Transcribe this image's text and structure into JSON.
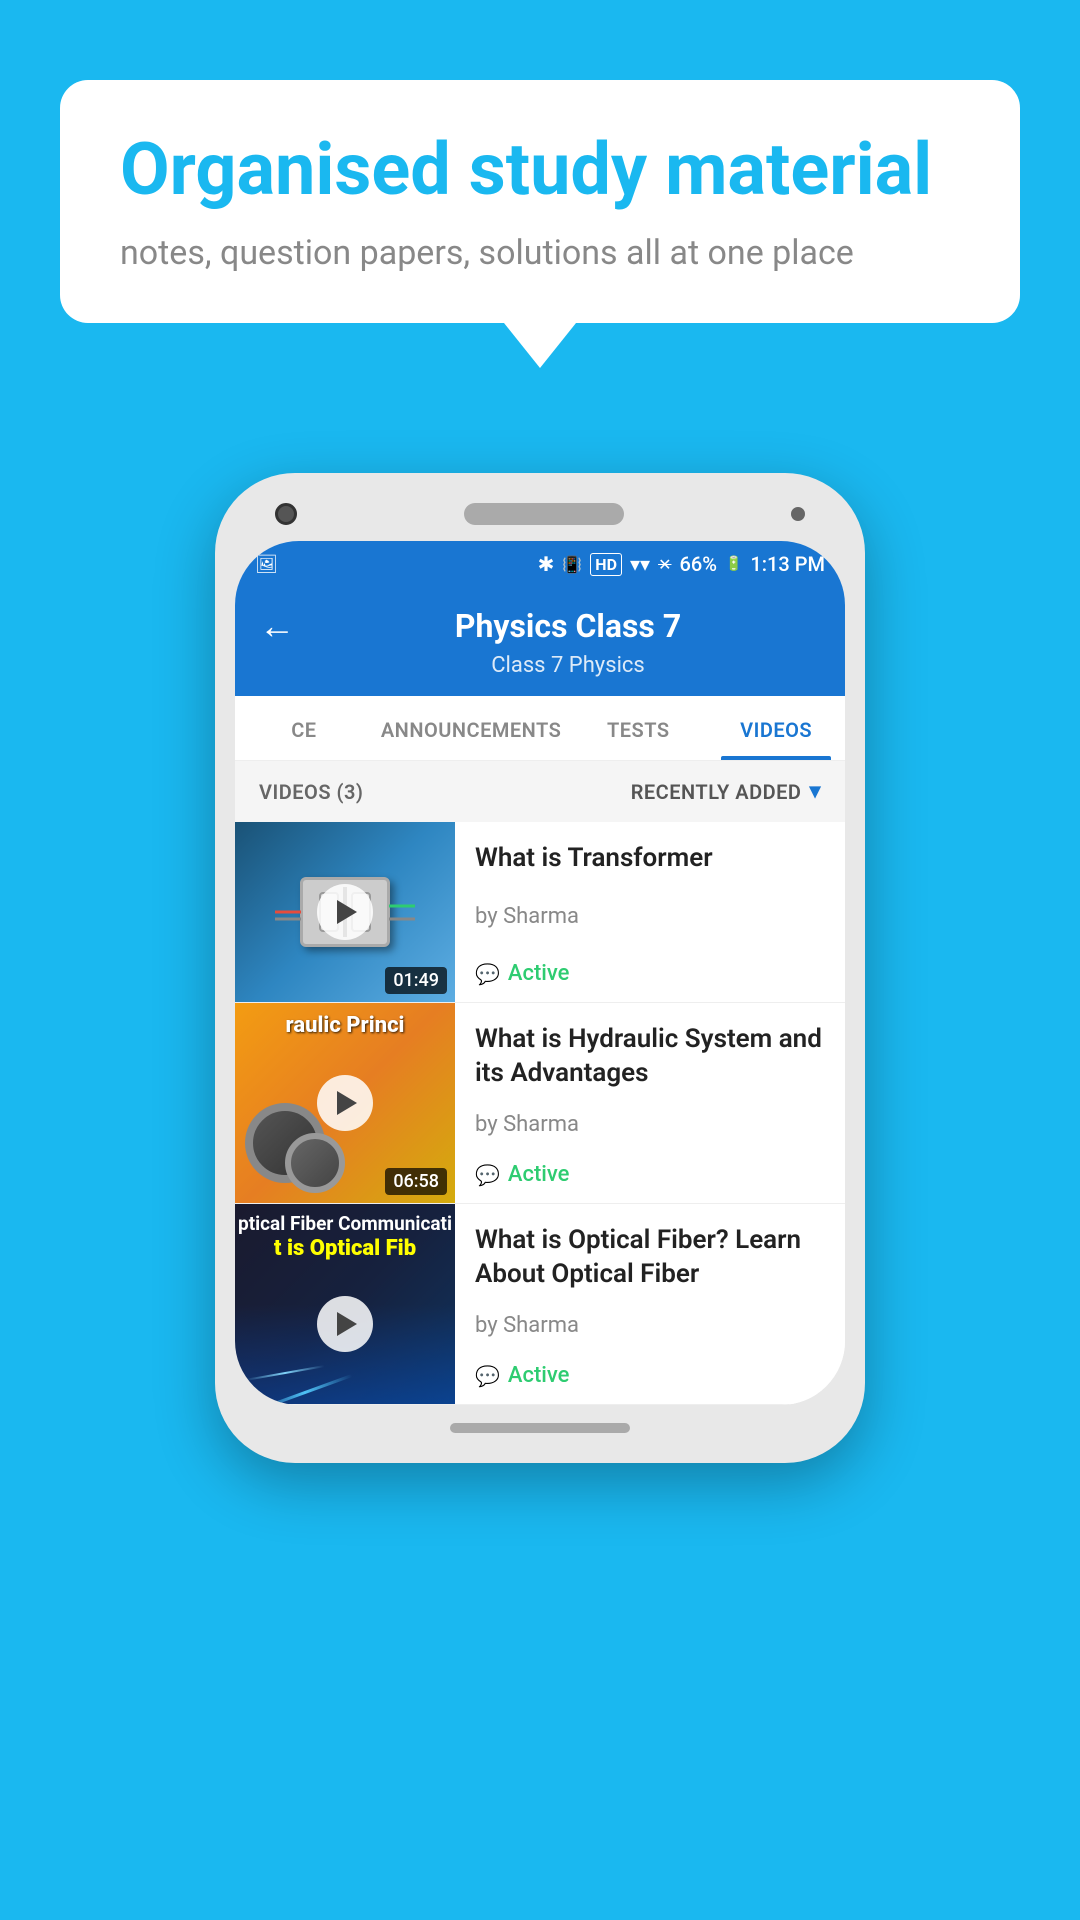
{
  "page": {
    "background_color": "#1ab8f0"
  },
  "speech_bubble": {
    "title": "Organised study material",
    "subtitle": "notes, question papers, solutions all at one place"
  },
  "status_bar": {
    "time": "1:13 PM",
    "battery": "66%",
    "signal_icons": "🔵📶📶"
  },
  "app_bar": {
    "back_label": "←",
    "title": "Physics Class 7",
    "breadcrumb": "Class 7   Physics"
  },
  "tabs": [
    {
      "id": "ce",
      "label": "CE",
      "active": false
    },
    {
      "id": "announcements",
      "label": "ANNOUNCEMENTS",
      "active": false
    },
    {
      "id": "tests",
      "label": "TESTS",
      "active": false
    },
    {
      "id": "videos",
      "label": "VIDEOS",
      "active": true
    }
  ],
  "videos_header": {
    "count_label": "VIDEOS (3)",
    "sort_label": "RECENTLY ADDED"
  },
  "videos": [
    {
      "id": 1,
      "title": "What is  Transformer",
      "author": "by Sharma",
      "status": "Active",
      "duration": "01:49",
      "thumb_type": "transformer"
    },
    {
      "id": 2,
      "title": "What is Hydraulic System and its Advantages",
      "author": "by Sharma",
      "status": "Active",
      "duration": "06:58",
      "thumb_type": "hydraulic",
      "thumb_text": "raulic Princi"
    },
    {
      "id": 3,
      "title": "What is Optical Fiber? Learn About Optical Fiber",
      "author": "by Sharma",
      "status": "Active",
      "duration": "",
      "thumb_type": "optical",
      "thumb_text_top": "ptical Fiber Communicati",
      "thumb_text_mid": "t is Optical Fib"
    }
  ],
  "icons": {
    "back": "←",
    "play": "▶",
    "chevron_down": "▾",
    "chat": "💬",
    "bluetooth": "🔵",
    "vibrate": "📳",
    "wifi": "📶",
    "signal": "📶"
  }
}
